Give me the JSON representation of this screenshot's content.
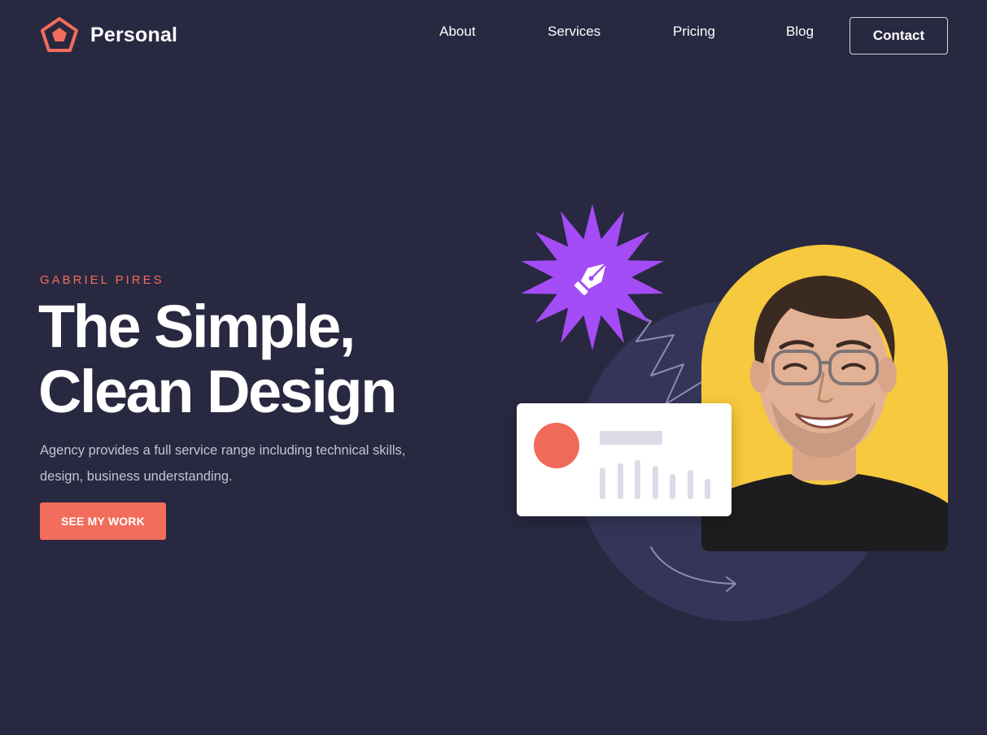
{
  "brand": {
    "name": "Personal",
    "logo_icon": "pentagon-logo-icon",
    "accent_color": "#f26d5b"
  },
  "nav": {
    "items": [
      {
        "label": "About"
      },
      {
        "label": "Services"
      },
      {
        "label": "Pricing"
      },
      {
        "label": "Blog"
      }
    ],
    "contact_label": "Contact"
  },
  "hero": {
    "eyebrow": "GABRIEL PIRES",
    "title_line1": "The Simple,",
    "title_line2": "Clean Design",
    "description": "Agency provides a full service range including technical skills, design, business understanding.",
    "cta_label": "SEE MY WORK"
  },
  "illustration": {
    "starburst_icon": "pen-nib-icon",
    "starburst_color": "#a44cf5",
    "arch_color": "#f6c93e",
    "background_circle_color": "#35355a",
    "card_dot_color": "#ef6a58",
    "card_bar_levels": [
      0.7,
      0.78,
      0.85,
      0.74,
      0.56,
      0.65,
      0.45
    ],
    "portrait": "smiling-man-with-glasses-portrait"
  },
  "colors": {
    "background": "#282841",
    "text": "#ffffff",
    "muted_text": "#c4c4d2"
  }
}
